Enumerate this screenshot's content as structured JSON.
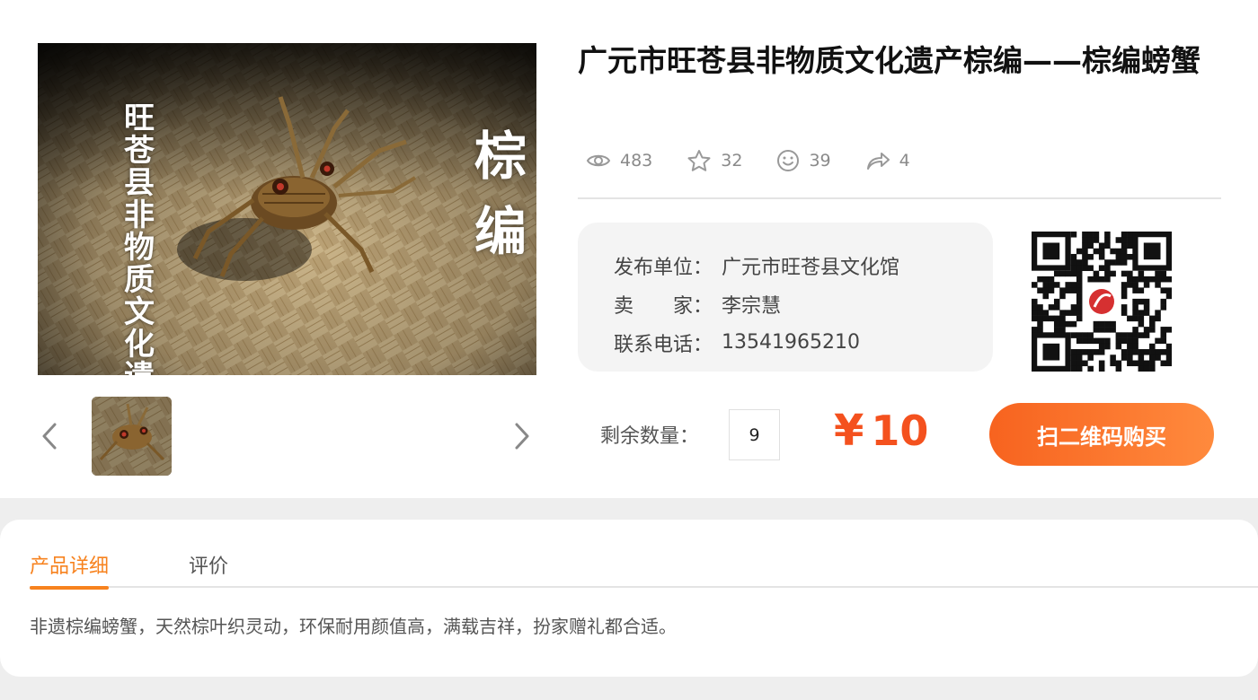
{
  "product": {
    "title": "广元市旺苍县非物质文化遗产棕编——棕编螃蟹",
    "image_text_left": "旺苍县非物质文化遗产",
    "image_text_right": "棕编"
  },
  "stats": {
    "views": "483",
    "favorites": "32",
    "likes": "39",
    "shares": "4"
  },
  "info": {
    "publisher_label": "发布单位：",
    "publisher_value": "广元市旺苍县文化馆",
    "seller_label": "卖　　家：",
    "seller_value": "李宗慧",
    "phone_label": "联系电话：",
    "phone_value": "13541965210"
  },
  "purchase": {
    "quantity_label": "剩余数量：",
    "quantity_value": "9",
    "price_symbol": "¥",
    "price_value": "10",
    "buy_label": "扫二维码购买"
  },
  "tabs": {
    "details": "产品详细",
    "reviews": "评价"
  },
  "description": "非遗棕编螃蟹，天然棕叶织灵动，环保耐用颜值高，满载吉祥，扮家赠礼都合适。",
  "icons": {
    "views": "eye-icon",
    "favorites": "star-icon",
    "likes": "smile-icon",
    "shares": "share-icon",
    "prev": "chevron-left-icon",
    "next": "chevron-right-icon"
  },
  "colors": {
    "accent": "#f4511e",
    "tab_active": "#f7821e",
    "button_start": "#f7631f",
    "button_end": "#ff8a3d"
  }
}
